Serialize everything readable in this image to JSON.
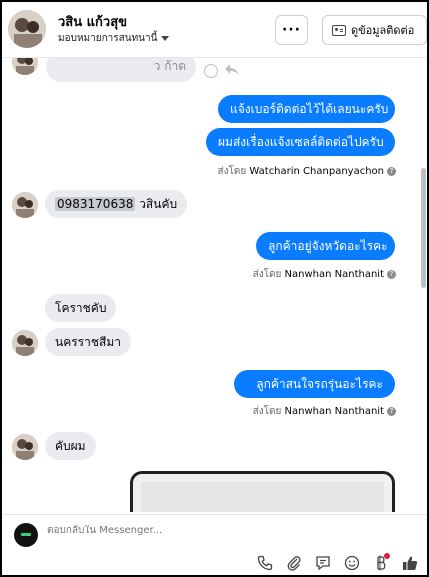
{
  "header": {
    "name": "วสิน แก้วสุข",
    "subtitle": "มอบหมายการสนทนานี้",
    "more_label": "···",
    "contact_button": "ดูข้อมูลติดต่อ"
  },
  "messages": {
    "partial_top": "ว ก้าต",
    "out1": "แจ้งเบอร์ติดต่อไว้ได้เลยนะครับ",
    "out2": "ผมส่งเรื่องแจ้งเซลล์ติดต่อไปครับ",
    "sent_by_1_prefix": "ส่งโดย",
    "sent_by_1_name": "Watcharin Chanpanyachon",
    "in1_phone": "0983170638",
    "in1_text": " วสินคับ",
    "out3": "ลูกค้าอยู่จังหวัดอะไรคะ",
    "sent_by_2_prefix": "ส่งโดย",
    "sent_by_2_name": "Nanwhan Nanthanit",
    "in2": "โคราชคับ",
    "in3": "นครราชสีมา",
    "out4": "ลูกค้าสนใจรถรุ่นอะไรคะ",
    "sent_by_3_prefix": "ส่งโดย",
    "sent_by_3_name": "Nanwhan Nanthanit",
    "in4": "คับผม"
  },
  "composer": {
    "placeholder": "ตอบกลับใน Messenger..."
  },
  "icons": {
    "tools": [
      "phone-icon",
      "attach-icon",
      "saved-reply-icon",
      "emoji-icon",
      "payment-icon",
      "like-icon"
    ]
  },
  "colors": {
    "outgoing": "#0a7cff",
    "incoming": "#e9ebef",
    "badge": "#e41e3f"
  }
}
